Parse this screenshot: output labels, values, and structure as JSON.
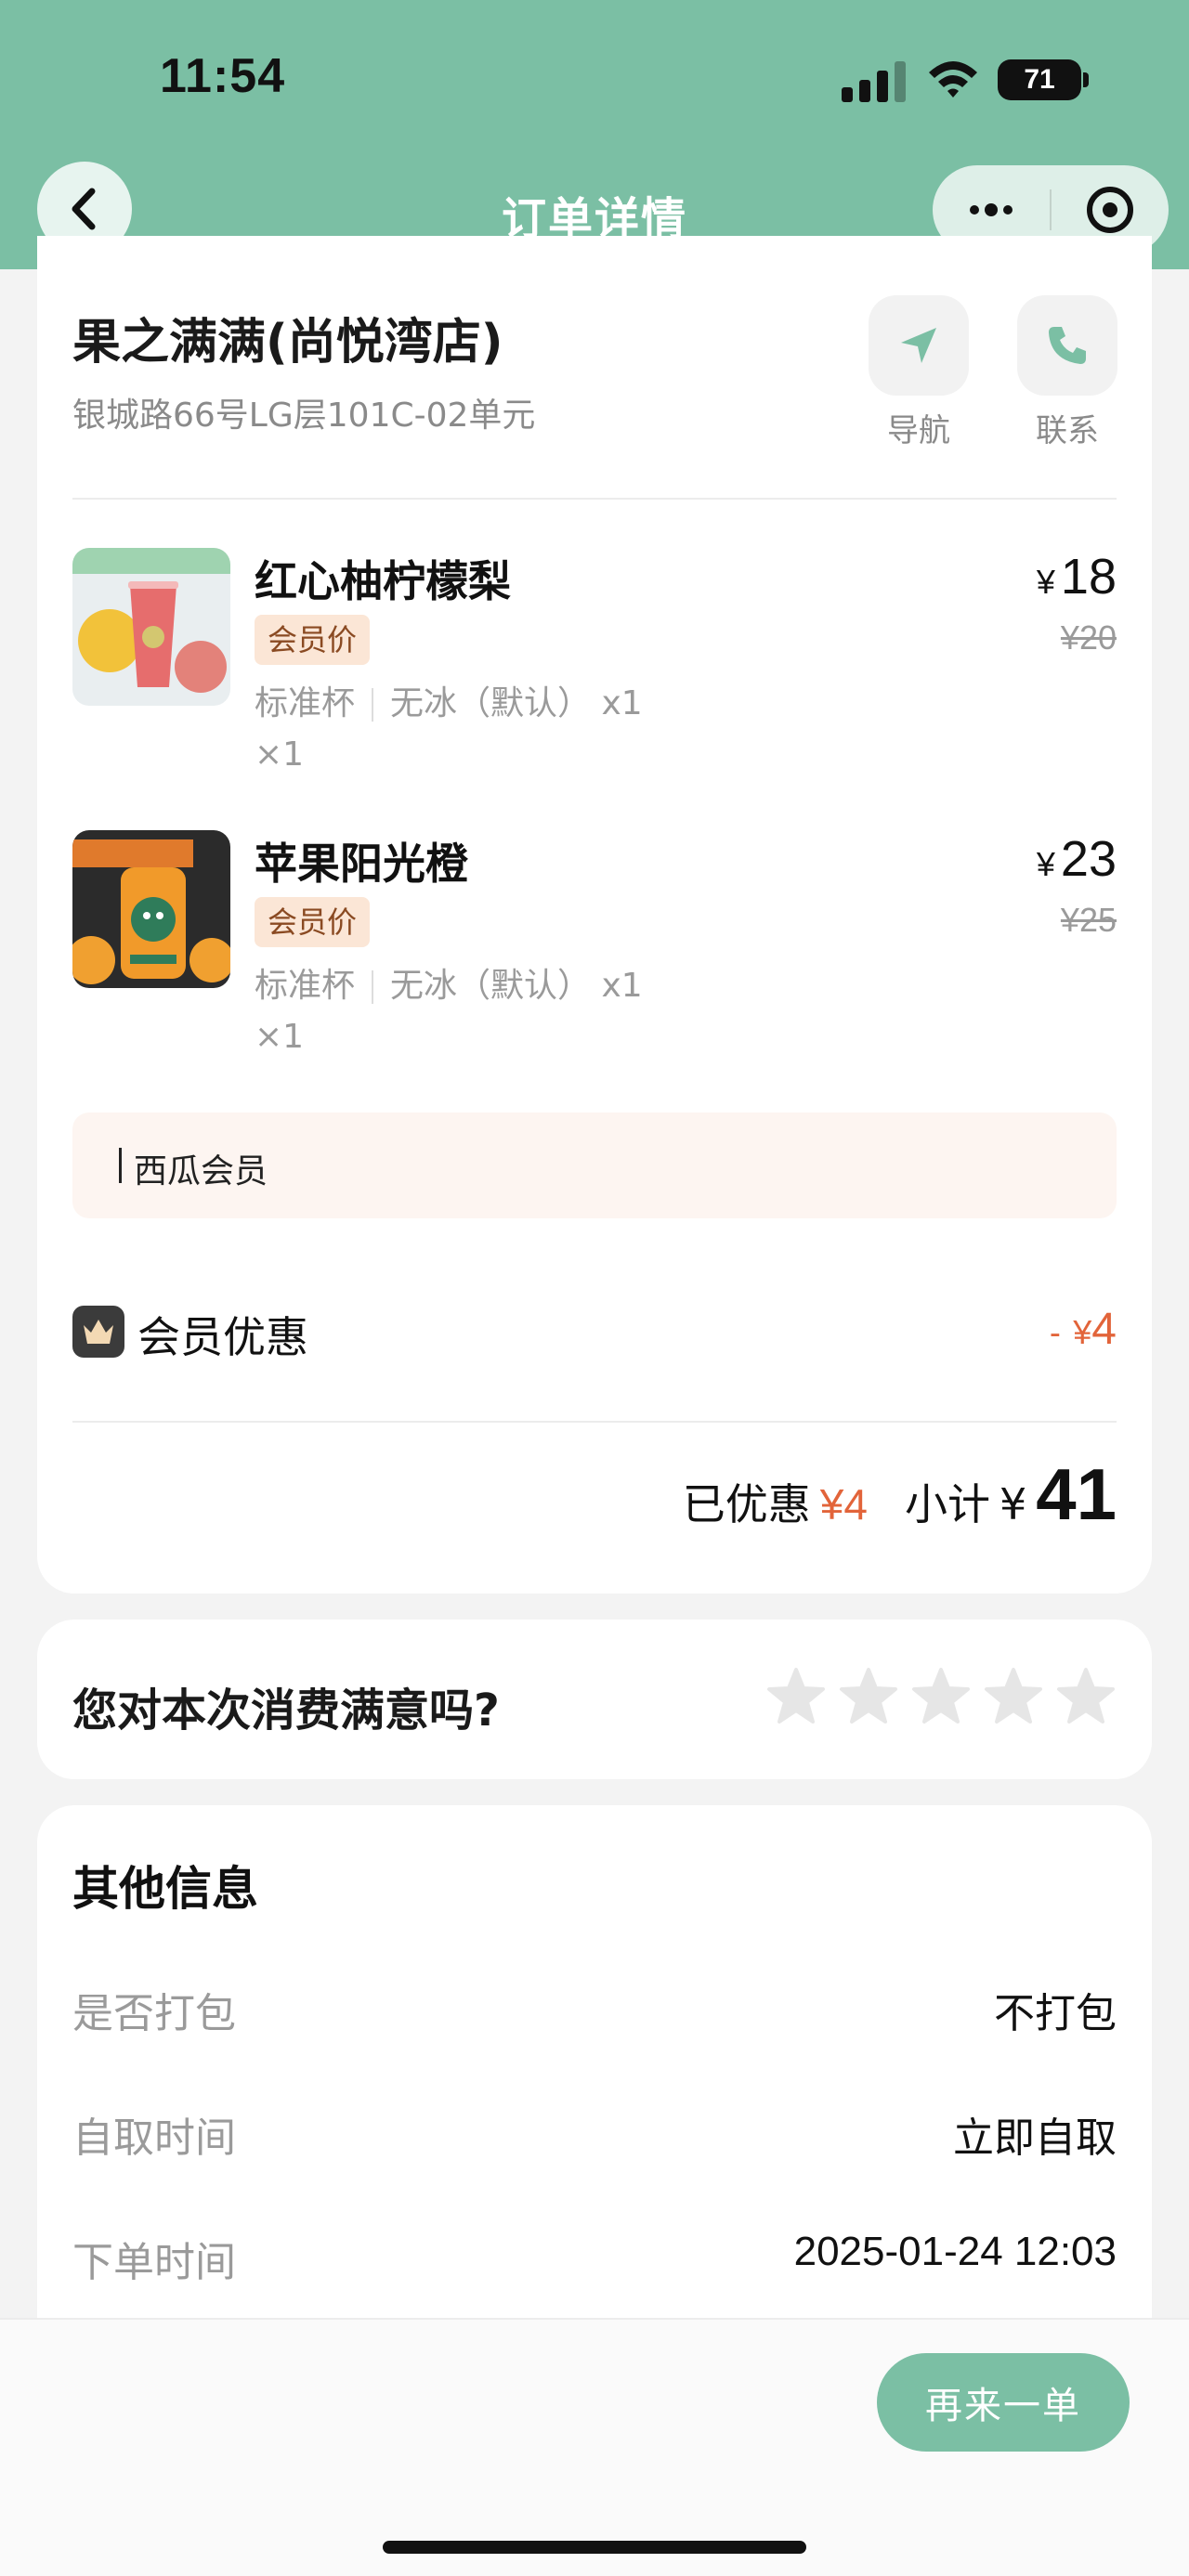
{
  "status_bar": {
    "time": "11:54",
    "battery": "71"
  },
  "nav": {
    "title": "订单详情"
  },
  "store": {
    "name": "果之满满(尚悦湾店)",
    "address": "银城路66号LG层101C-02单元",
    "navigate_label": "导航",
    "contact_label": "联系"
  },
  "items": [
    {
      "name": "红心柚柠檬梨",
      "tag": "会员价",
      "spec_size": "标准杯",
      "spec_ice": "无冰（默认） x1",
      "qty": "×1",
      "currency": "¥",
      "price": "18",
      "original_price": "¥20"
    },
    {
      "name": "苹果阳光橙",
      "tag": "会员价",
      "spec_size": "标准杯",
      "spec_ice": "无冰（默认） x1",
      "qty": "×1",
      "currency": "¥",
      "price": "23",
      "original_price": "¥25"
    }
  ],
  "membership": {
    "label": "西瓜会员"
  },
  "discount": {
    "label": "会员优惠",
    "sign": "-",
    "currency": "¥",
    "value": "4"
  },
  "summary": {
    "saved_label": "已优惠",
    "saved_value": "¥4",
    "subtotal_label": "小计",
    "currency": "¥",
    "subtotal": "41"
  },
  "rating": {
    "question": "您对本次消费满意吗?",
    "stars": 5,
    "selected": 0
  },
  "other_info": {
    "title": "其他信息",
    "rows": [
      {
        "key": "是否打包",
        "value": "不打包"
      },
      {
        "key": "自取时间",
        "value": "立即自取"
      },
      {
        "key": "下单时间",
        "value": "2025-01-24 12:03"
      }
    ]
  },
  "actions": {
    "reorder": "再来一单"
  },
  "colors": {
    "brand": "#7bbfa4",
    "accent": "#e2643a",
    "tag_bg": "#fbe6d6"
  }
}
